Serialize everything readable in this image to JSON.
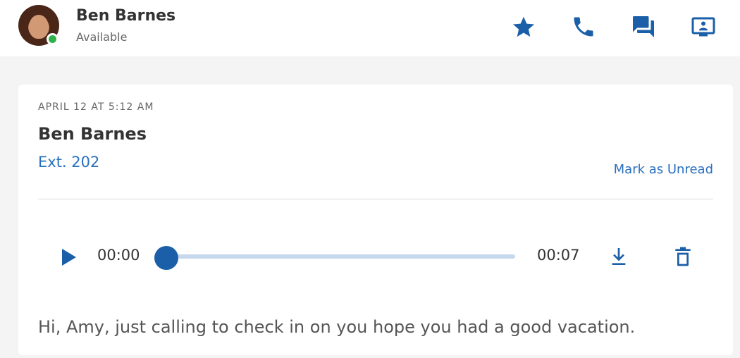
{
  "contact": {
    "name": "Ben Barnes",
    "status": "Available",
    "presence_color": "#2db24a",
    "avatar_icon": "user-avatar-photo"
  },
  "header_actions": [
    {
      "icon": "star-icon",
      "label": "favorite"
    },
    {
      "icon": "phone-icon",
      "label": "call"
    },
    {
      "icon": "chat-icon",
      "label": "message"
    },
    {
      "icon": "screen-share-icon",
      "label": "share screen"
    }
  ],
  "voicemail": {
    "timestamp": "APRIL 12 AT 5:12 AM",
    "caller_name": "Ben Barnes",
    "extension": "Ext. 202",
    "mark_unread_label": "Mark as Unread",
    "player": {
      "current_time": "00:00",
      "duration": "00:07",
      "progress_fraction": 0.0,
      "play_icon": "play-icon",
      "download_icon": "download-icon",
      "delete_icon": "trash-icon"
    },
    "transcript": "Hi, Amy, just calling to check in on you hope you had a good vacation."
  },
  "colors": {
    "accent": "#1a5fa8",
    "link": "#2a6fbf",
    "track": "#c6d8ec",
    "background": "#f4f4f4"
  }
}
